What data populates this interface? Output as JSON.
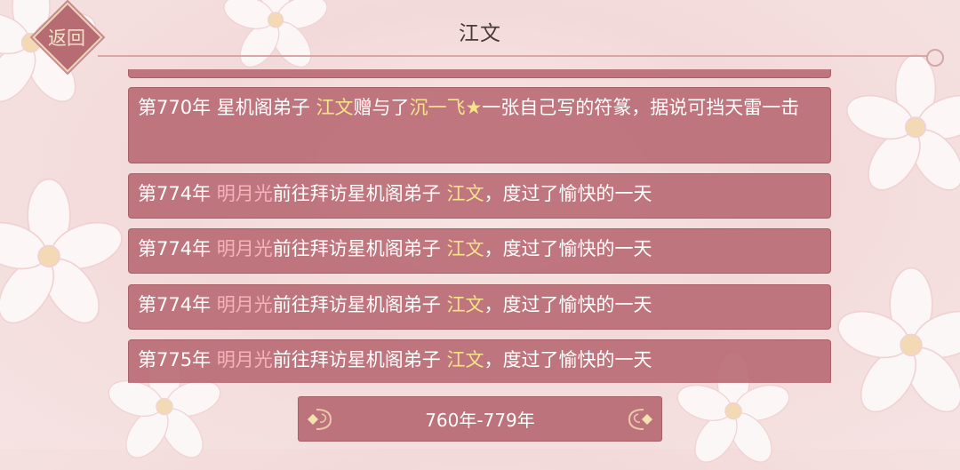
{
  "header": {
    "title": "江文",
    "back_label": "返回"
  },
  "entries": [
    {
      "year": "第770年",
      "t1": " 星机阁弟子 ",
      "n1": "江文",
      "t2": "赠与了",
      "n2": "沉一飞★",
      "t3": "一张自己写的符篆，据说可挡天雷一击"
    },
    {
      "year": "第774年",
      "n1": "明月光",
      "t1": "前往拜访星机阁弟子 ",
      "n2": "江文",
      "t2": "，度过了愉快的一天"
    },
    {
      "year": "第774年",
      "n1": "明月光",
      "t1": "前往拜访星机阁弟子 ",
      "n2": "江文",
      "t2": "，度过了愉快的一天"
    },
    {
      "year": "第774年",
      "n1": "明月光",
      "t1": "前往拜访星机阁弟子 ",
      "n2": "江文",
      "t2": "，度过了愉快的一天"
    },
    {
      "year": "第775年",
      "n1": "明月光",
      "t1": "前往拜访星机阁弟子 ",
      "n2": "江文",
      "t2": "，度过了愉快的一天"
    }
  ],
  "pager": {
    "range_label": "760年-779年"
  },
  "colors": {
    "entry_bg": "#b76770",
    "highlight_name_yellow": "#f8e58a",
    "highlight_name_pink": "#f7b4b8"
  }
}
